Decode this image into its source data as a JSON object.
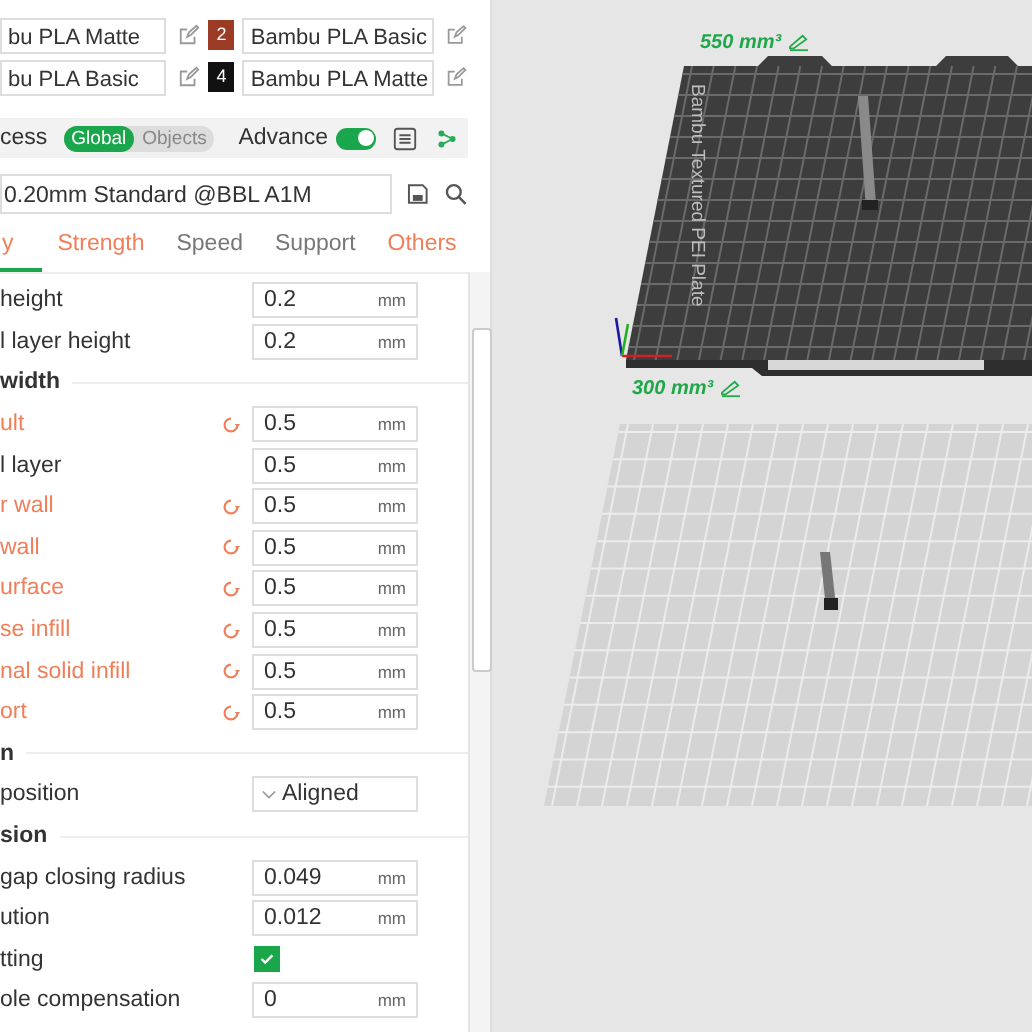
{
  "filaments": [
    {
      "label": "bu PLA Matte"
    },
    {
      "index": "2",
      "color": "#9c3b25",
      "label": "Bambu PLA Basic"
    },
    {
      "label": "bu PLA Basic"
    },
    {
      "index": "4",
      "color": "#111111",
      "label": "Bambu PLA Matte"
    }
  ],
  "process": {
    "label": "cess",
    "modes": [
      {
        "label": "Global",
        "selected": true
      },
      {
        "label": "Objects",
        "selected": false
      }
    ],
    "advance": {
      "label": "Advance",
      "on": true
    }
  },
  "preset": {
    "value": "0.20mm Standard @BBL A1M"
  },
  "tabs": [
    {
      "label": "y",
      "selected": true,
      "modified": true
    },
    {
      "label": "Strength",
      "selected": false,
      "modified": true
    },
    {
      "label": "Speed",
      "selected": false,
      "modified": false
    },
    {
      "label": "Support",
      "selected": false,
      "modified": false
    },
    {
      "label": "Others",
      "selected": false,
      "modified": true
    }
  ],
  "settings": [
    {
      "kind": "field",
      "label": "height",
      "modified": false,
      "reset": false,
      "value": "0.2",
      "unit": "mm"
    },
    {
      "kind": "field",
      "label": "l layer height",
      "modified": false,
      "reset": false,
      "value": "0.2",
      "unit": "mm"
    },
    {
      "kind": "section",
      "label": "width"
    },
    {
      "kind": "field",
      "label": "ult",
      "modified": true,
      "reset": true,
      "value": "0.5",
      "unit": "mm"
    },
    {
      "kind": "field",
      "label": "l layer",
      "modified": false,
      "reset": false,
      "value": "0.5",
      "unit": "mm"
    },
    {
      "kind": "field",
      "label": "r wall",
      "modified": true,
      "reset": true,
      "value": "0.5",
      "unit": "mm"
    },
    {
      "kind": "field",
      "label": "wall",
      "modified": true,
      "reset": true,
      "value": "0.5",
      "unit": "mm"
    },
    {
      "kind": "field",
      "label": "urface",
      "modified": true,
      "reset": true,
      "value": "0.5",
      "unit": "mm"
    },
    {
      "kind": "field",
      "label": "se infill",
      "modified": true,
      "reset": true,
      "value": "0.5",
      "unit": "mm"
    },
    {
      "kind": "field",
      "label": "nal solid infill",
      "modified": true,
      "reset": true,
      "value": "0.5",
      "unit": "mm"
    },
    {
      "kind": "field",
      "label": "ort",
      "modified": true,
      "reset": true,
      "value": "0.5",
      "unit": "mm"
    },
    {
      "kind": "section",
      "label": "n"
    },
    {
      "kind": "dropdown",
      "label": "position",
      "value": "Aligned"
    },
    {
      "kind": "section",
      "label": "sion"
    },
    {
      "kind": "field",
      "label": "gap closing radius",
      "modified": false,
      "reset": false,
      "value": "0.049",
      "unit": "mm"
    },
    {
      "kind": "field",
      "label": "ution",
      "modified": false,
      "reset": false,
      "value": "0.012",
      "unit": "mm"
    },
    {
      "kind": "checkbox",
      "label": "tting",
      "checked": true
    },
    {
      "kind": "field",
      "label": "ole compensation",
      "modified": false,
      "reset": false,
      "value": "0",
      "unit": "mm"
    }
  ],
  "plates": [
    {
      "kind": "dark",
      "volume": "550 mm³",
      "name": "Bambu Textured PEI Plate"
    },
    {
      "kind": "light",
      "volume": "300 mm³"
    }
  ]
}
